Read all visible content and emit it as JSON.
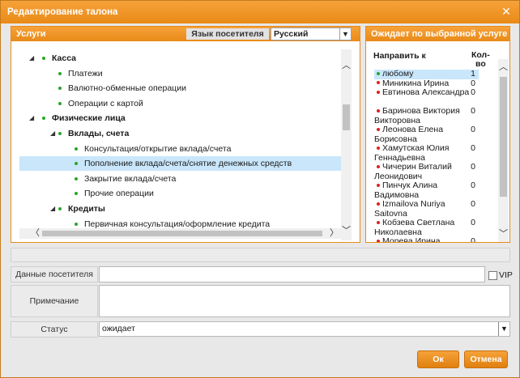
{
  "dialog": {
    "title": "Редактирование талона"
  },
  "services": {
    "header": "Услуги",
    "language_label": "Язык посетителя",
    "language_value": "Русский",
    "tree": [
      {
        "label": "Касса",
        "level": 0,
        "bold": true,
        "toggle": true
      },
      {
        "label": "Платежи",
        "level": 1
      },
      {
        "label": "Валютно-обменные операции",
        "level": 1
      },
      {
        "label": "Операции с картой",
        "level": 1
      },
      {
        "label": "Физические лица",
        "level": 0,
        "bold": true,
        "toggle": true
      },
      {
        "label": "Вклады, счета",
        "level": 1,
        "bold": true,
        "toggle": true
      },
      {
        "label": "Консультация/открытие вклада/счета",
        "level": 2
      },
      {
        "label": "Пополнение вклада/счета/снятие денежных средств",
        "level": 2,
        "selected": true
      },
      {
        "label": "Закрытие вклада/счета",
        "level": 2
      },
      {
        "label": "Прочие операции",
        "level": 2
      },
      {
        "label": "Кредиты",
        "level": 1,
        "bold": true,
        "toggle": true
      },
      {
        "label": "Первичная консультация/оформление кредита",
        "level": 2
      }
    ]
  },
  "queue": {
    "header": "Ожидает по выбранной услуге",
    "col_direct": "Направить к",
    "col_count": "Кол-\nво",
    "rows": [
      {
        "name": "любому",
        "count": "1",
        "selected": true,
        "green": true
      },
      {
        "name": "Миникина Ирина",
        "count": "0"
      },
      {
        "name": "Евтинова Александра",
        "count": "0"
      },
      {
        "name": "Баринова Виктория Викторовна",
        "count": "0"
      },
      {
        "name": "Леонова Елена Борисовна",
        "count": "0"
      },
      {
        "name": "Хамутская Юлия Геннадьевна",
        "count": "0"
      },
      {
        "name": "Чичерин Виталий Леонидович",
        "count": "0"
      },
      {
        "name": "Пинчук Алина Вадимовна",
        "count": "0"
      },
      {
        "name": "Izmailova Nuriya Saitovna",
        "count": "0"
      },
      {
        "name": "Кобзева Светлана Николаевна",
        "count": "0"
      },
      {
        "name": "Морева Ирина Владимировна",
        "count": "0"
      }
    ]
  },
  "form": {
    "visitor_label": "Данные посетителя",
    "visitor_value": "",
    "vip_label": "VIP",
    "note_label": "Примечание",
    "note_value": "",
    "status_label": "Статус",
    "status_value": "ожидает"
  },
  "buttons": {
    "ok": "Ок",
    "cancel": "Отмена"
  }
}
